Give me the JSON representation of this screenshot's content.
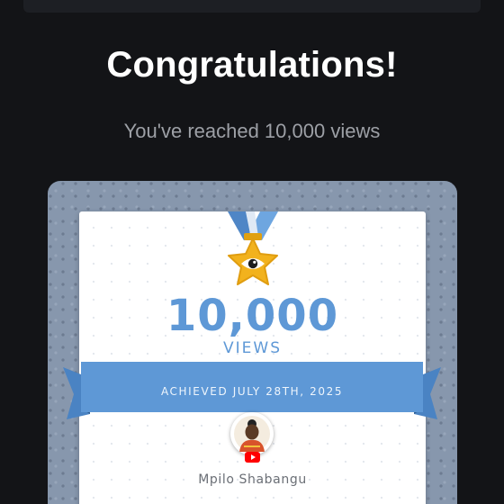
{
  "headline": "Congratulations!",
  "subline": "You've reached 10,000 views",
  "card": {
    "milestone_number": "10,000",
    "milestone_unit": "VIEWS",
    "achieved_text": "ACHIEVED JULY 28TH, 2025",
    "creator_name": "Mpilo Shabangu",
    "medal_icon": "eye-star-medal-icon",
    "platform_icon": "youtube-icon"
  },
  "colors": {
    "background": "#131417",
    "accent_blue": "#5e98d6",
    "medal_gold": "#f2b21d",
    "frame": "#8797ad"
  }
}
